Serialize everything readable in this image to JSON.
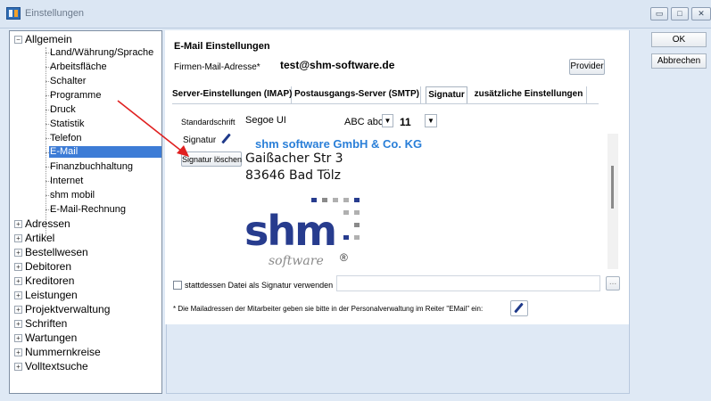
{
  "window": {
    "title": "Einstellungen",
    "minimize_label": "▭",
    "maximize_label": "□",
    "close_label": "✕"
  },
  "tree": {
    "roots": [
      {
        "expander": "−",
        "label": "Allgemein"
      },
      {
        "expander": "+",
        "label": "Adressen"
      },
      {
        "expander": "+",
        "label": "Artikel"
      },
      {
        "expander": "+",
        "label": "Bestellwesen"
      },
      {
        "expander": "+",
        "label": "Debitoren"
      },
      {
        "expander": "+",
        "label": "Kreditoren"
      },
      {
        "expander": "+",
        "label": "Leistungen"
      },
      {
        "expander": "+",
        "label": "Projektverwaltung"
      },
      {
        "expander": "+",
        "label": "Schriften"
      },
      {
        "expander": "+",
        "label": "Wartungen"
      },
      {
        "expander": "+",
        "label": "Nummernkreise"
      },
      {
        "expander": "+",
        "label": "Volltextsuche"
      }
    ],
    "children": [
      "Land/Währung/Sprache",
      "Arbeitsfläche",
      "Schalter",
      "Programme",
      "Druck",
      "Statistik",
      "Telefon",
      "E-Mail",
      "Finanzbuchhaltung",
      "Internet",
      "shm mobil",
      "E-Mail-Rechnung"
    ],
    "selected": "E-Mail"
  },
  "email": {
    "section_title": "E-Mail Einstellungen",
    "firm_address_label": "Firmen-Mail-Adresse*",
    "firm_address_value": "test@shm-software.de",
    "provider_button": "Provider"
  },
  "tabs": [
    {
      "label": "Server-Einstellungen (IMAP)",
      "active": false
    },
    {
      "label": "Postausgangs-Server (SMTP)",
      "active": false
    },
    {
      "label": "Signatur",
      "active": true
    },
    {
      "label": "zusätzliche Einstellungen",
      "active": false
    }
  ],
  "signature": {
    "font_label": "Standardschrift",
    "font_name": "Segoe UI",
    "font_preview": "ABC abc",
    "font_size": "11",
    "signature_label": "Signatur",
    "delete_button": "Signatur löschen",
    "company": "shm software GmbH & Co. KG",
    "street": "Gaißacher Str 3",
    "city": "83646 Bad Tölz",
    "logo_word": "shm",
    "logo_sub": "software",
    "logo_reg": "®",
    "use_file_label": "stattdessen Datei als Signatur verwenden",
    "use_file_checked": false,
    "browse_button": "...",
    "footnote": "* Die Mailadressen der Mitarbeiter geben sie bitte in der Personalverwaltung im Reiter \"EMail\"  ein:"
  },
  "dialog": {
    "ok_button": "OK",
    "cancel_button": "Abbrechen"
  },
  "colors": {
    "accent_blue": "#3d7cd6",
    "company_blue": "#2a7fd8",
    "logo_navy": "#273c8e",
    "annotation_red": "#e02020"
  }
}
